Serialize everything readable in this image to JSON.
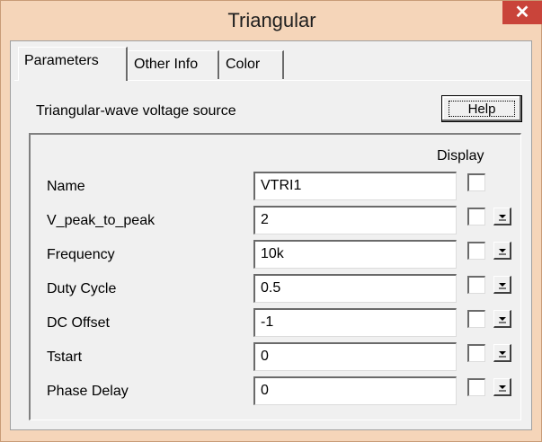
{
  "window": {
    "title": "Triangular",
    "close_glyph": "✕"
  },
  "tabs": [
    {
      "label": "Parameters",
      "active": true
    },
    {
      "label": "Other Info",
      "active": false
    },
    {
      "label": "Color",
      "active": false
    }
  ],
  "description": "Triangular-wave voltage source",
  "help_label": "Help",
  "display_header": "Display",
  "params": [
    {
      "label": "Name",
      "value": "VTRI1",
      "display_checked": false,
      "has_dropdown": false
    },
    {
      "label": "V_peak_to_peak",
      "value": "2",
      "display_checked": false,
      "has_dropdown": true
    },
    {
      "label": "Frequency",
      "value": "10k",
      "display_checked": false,
      "has_dropdown": true
    },
    {
      "label": "Duty Cycle",
      "value": "0.5",
      "display_checked": false,
      "has_dropdown": true
    },
    {
      "label": "DC Offset",
      "value": "-1",
      "display_checked": false,
      "has_dropdown": true
    },
    {
      "label": "Tstart",
      "value": "0",
      "display_checked": false,
      "has_dropdown": true
    },
    {
      "label": "Phase Delay",
      "value": "0",
      "display_checked": false,
      "has_dropdown": true
    }
  ],
  "colors": {
    "frame": "#f5d5b9",
    "close_button": "#c9443a",
    "dialog": "#f0f0f0"
  }
}
